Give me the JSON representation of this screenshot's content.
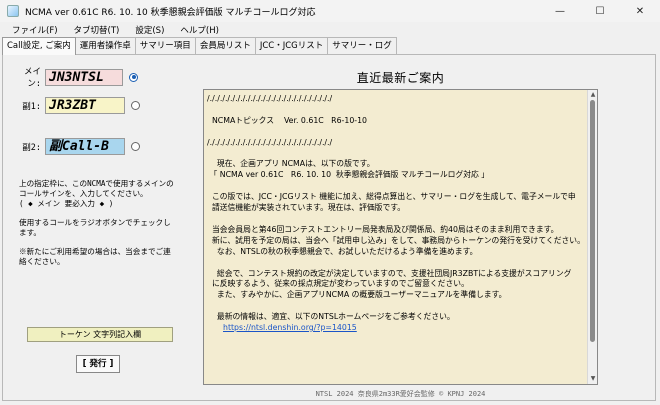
{
  "window": {
    "title": "NCMA ver 0.61C  R6. 10. 10   秋季懇親会評価版 マルチコールログ対応",
    "minimize": "—",
    "maximize": "☐",
    "close": "✕"
  },
  "menu": [
    {
      "label": "ファイル(F)"
    },
    {
      "label": "タブ切替(T)"
    },
    {
      "label": "設定(S)"
    },
    {
      "label": "ヘルプ(H)"
    }
  ],
  "tabs": [
    {
      "label": "Call設定, ご案内"
    },
    {
      "label": "運用者操作卓"
    },
    {
      "label": "サマリー項目"
    },
    {
      "label": "会員局リスト"
    },
    {
      "label": "JCC・JCGリスト"
    },
    {
      "label": "サマリー・ログ"
    }
  ],
  "callsigns": {
    "main": {
      "label": "メイン:",
      "value": "JN3NTSL",
      "color": "#f6dcdc"
    },
    "sub1": {
      "label": "副1:",
      "value": "JR3ZBT",
      "color": "#f8f4c8"
    },
    "sub2": {
      "label": "副2:",
      "value": "副Call-B",
      "color": "#a9d6ee"
    }
  },
  "instructions": [
    "上の指定枠に、このNCMAで使用するメインのコールサインを、入力してください。\n( ◆ メイン 要必入力 ◆ )",
    "使用するコールをラジオボタンでチェックします。",
    "※新たにご利用希望の場合は、当会までご連絡ください。"
  ],
  "buttons": {
    "token": "トーケン 文字列記入欄",
    "issue": "[ 発行 ]"
  },
  "info": {
    "heading": "直近最新ご案内",
    "lines": [
      "/././././././././././././././././././././././././",
      "",
      "  NCMAトピックス    Ver. 0.61C   R6-10-10",
      "",
      "/././././././././././././././././././././././././",
      "",
      "    現在、企画アプリ NCMAは、以下の版です。",
      " 「 NCMA ver 0.61C   R6. 10. 10  秋季懇親会評価版 マルチコールログ対応 」",
      "",
      "  この版では、JCC・JCGリスト 機能に加え、総得点算出と、サマリー・ログを生成して、電子メールで申",
      "  請送信機能が実装されています。現在は、評価版です。",
      "",
      "  当会会員局と第46回コンテストエントリー局発表局及び関係局、約40局はそのまま利用できます。",
      "  新に、試用を予定の局は、当会へ「試用申し込み」をして、事務局からトーケンの発行を受けてください。",
      "    なお、NTSLの秋の秋季懇親会で、お試しいただけるよう準備を進めます。",
      "",
      "    総会で、コンテスト規約の改定が決定していますので、支援社団局JR3ZBTによる支援がスコアリング",
      "  に反映するよう、従来の採点規定が変わっていますのでご留意ください。",
      "    また、すみやかに、企画アプリNCMA の概要版ユーザーマニュアルを準備します。",
      "",
      "    最新の情報は、適宜、以下のNTSLホームページをご参考ください。"
    ],
    "link": "https://ntsl.denshin.org/?p=14015"
  },
  "footer": "NTSL 2024 奈良県2m33R愛好会監修  © KPNJ 2024"
}
